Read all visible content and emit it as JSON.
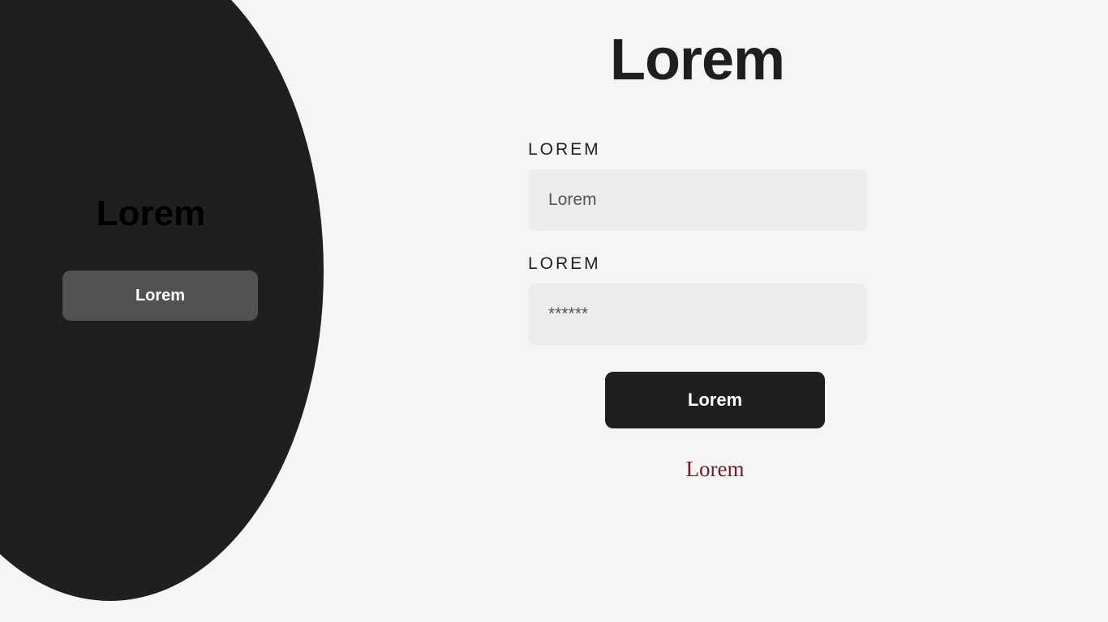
{
  "side_panel": {
    "title": "Lorem",
    "button_label": "Lorem"
  },
  "form": {
    "title": "Lorem",
    "field_1": {
      "label": "LOREM",
      "placeholder": "Lorem"
    },
    "field_2": {
      "label": "LOREM",
      "placeholder": "******"
    },
    "submit_label": "Lorem",
    "footer_link": "Lorem"
  },
  "colors": {
    "background": "#f5f5f5",
    "dark": "#1e2020",
    "side_button": "#525252",
    "input_fill": "#ececec",
    "link": "#6b1e2a"
  }
}
